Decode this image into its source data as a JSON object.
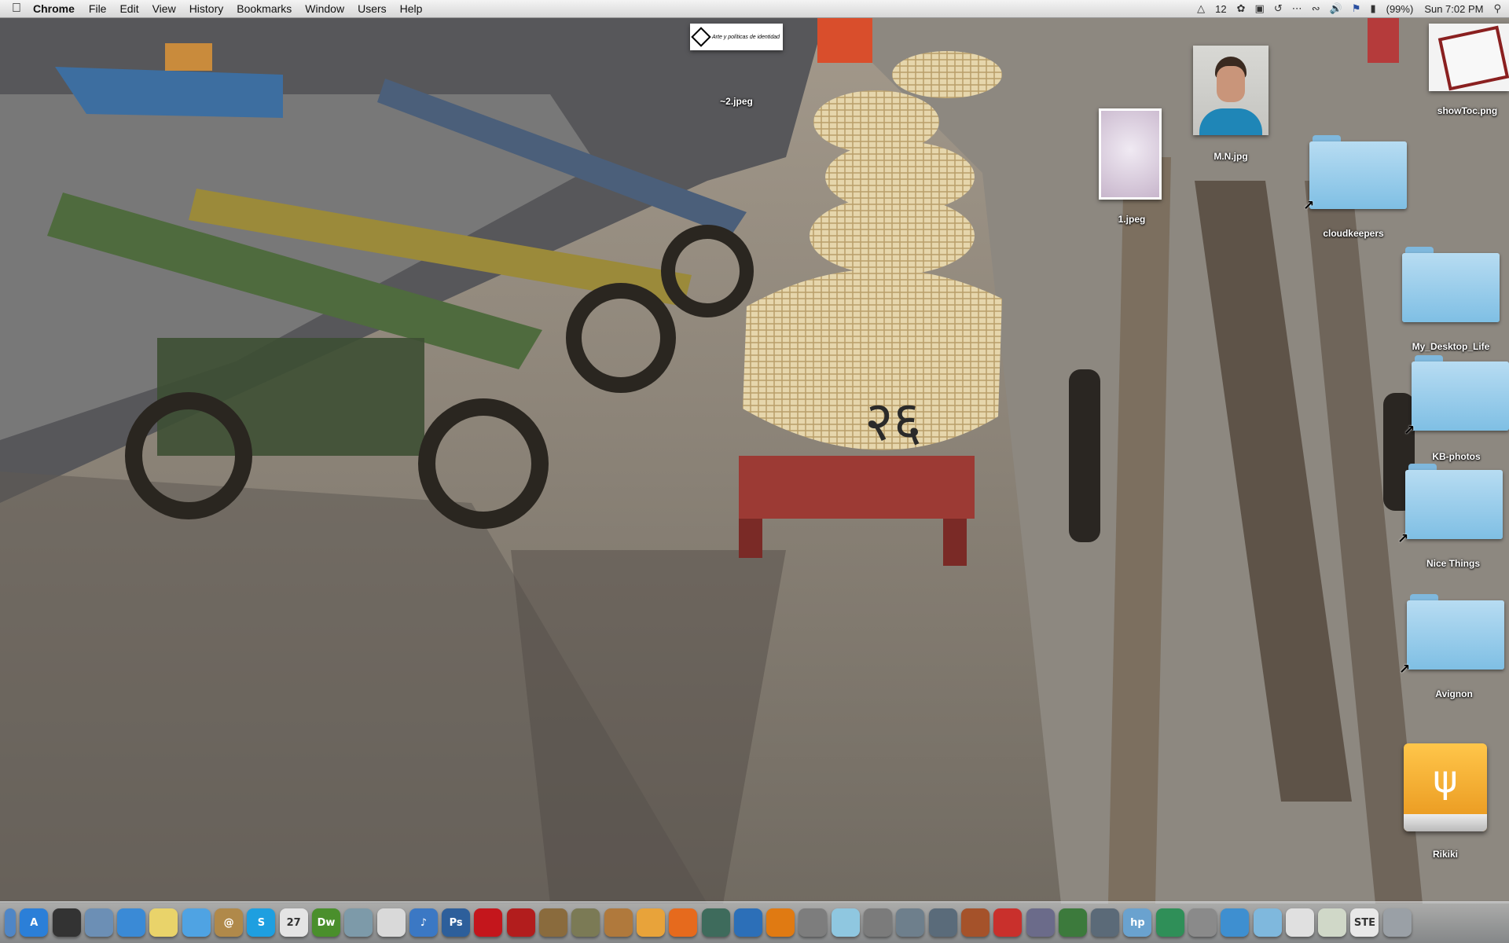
{
  "menubar": {
    "apple_icon": "apple-icon",
    "app_name": "Chrome",
    "menus": [
      "File",
      "Edit",
      "View",
      "History",
      "Bookmarks",
      "Window",
      "Users",
      "Help"
    ],
    "status_items": {
      "adobe_count": "12",
      "battery": "(99%)",
      "clock": "Sun 7:02 PM"
    },
    "status_icons": [
      "adobe-icon",
      "growl-icon",
      "display-icon",
      "time-machine-icon",
      "more-icon",
      "wifi-icon",
      "volume-icon",
      "flag-icon",
      "battery-icon",
      "spotlight-icon"
    ]
  },
  "desktop": {
    "items": [
      {
        "label": "~2.jpeg",
        "kind": "image"
      },
      {
        "label": "1.jpeg",
        "kind": "image"
      },
      {
        "label": "M.N.jpg",
        "kind": "image"
      },
      {
        "label": "showToc.png",
        "kind": "image"
      },
      {
        "label": "cloudkeepers",
        "kind": "folder-alias"
      },
      {
        "label": "My_Desktop_Life",
        "kind": "folder"
      },
      {
        "label": "KB-photos",
        "kind": "folder-alias"
      },
      {
        "label": "Nice Things",
        "kind": "folder-alias"
      },
      {
        "label": "Avignon",
        "kind": "folder-alias"
      },
      {
        "label": "Rikiki",
        "kind": "usb-drive"
      }
    ],
    "thumb_caption": "Arte y políticas de identidad"
  },
  "dock": {
    "items": [
      {
        "name": "finder-icon",
        "text": "",
        "color": "#4f86c6"
      },
      {
        "name": "app-store-icon",
        "text": "A",
        "color": "#2b7fd8"
      },
      {
        "name": "dashboard-icon",
        "text": "",
        "color": "#333333"
      },
      {
        "name": "preview-icon",
        "text": "",
        "color": "#6c8fb5"
      },
      {
        "name": "safari-icon",
        "text": "",
        "color": "#3a8ad6"
      },
      {
        "name": "stickies-icon",
        "text": "",
        "color": "#e9d36a"
      },
      {
        "name": "ichat-icon",
        "text": "",
        "color": "#4fa3e3"
      },
      {
        "name": "address-book-icon",
        "text": "@",
        "color": "#b0894a"
      },
      {
        "name": "skype-icon",
        "text": "S",
        "color": "#1e9fe0"
      },
      {
        "name": "ical-icon",
        "text": "27",
        "color": "#e4e4e4"
      },
      {
        "name": "dreamweaver-icon",
        "text": "Dw",
        "color": "#4a8f2c"
      },
      {
        "name": "iphoto-icon",
        "text": "",
        "color": "#7d9aa9"
      },
      {
        "name": "textedit-icon",
        "text": "",
        "color": "#d9d9d9"
      },
      {
        "name": "itunes-icon",
        "text": "♪",
        "color": "#3b78c4"
      },
      {
        "name": "photoshop-icon",
        "text": "Ps",
        "color": "#2d5f9b"
      },
      {
        "name": "acrobat-icon",
        "text": "",
        "color": "#c4161c"
      },
      {
        "name": "photo-booth-icon",
        "text": "",
        "color": "#b21d1d"
      },
      {
        "name": "image-capture-icon",
        "text": "",
        "color": "#8a6b3d"
      },
      {
        "name": "star-app-icon",
        "text": "",
        "color": "#7b7a55"
      },
      {
        "name": "garageband-icon",
        "text": "",
        "color": "#b0793c"
      },
      {
        "name": "chrome-icon",
        "text": "",
        "color": "#e8a33a"
      },
      {
        "name": "firefox-icon",
        "text": "",
        "color": "#e66a1d"
      },
      {
        "name": "time-machine-icon",
        "text": "",
        "color": "#3e6b5c"
      },
      {
        "name": "quicktime-icon",
        "text": "",
        "color": "#2c6fb8"
      },
      {
        "name": "vlc-icon",
        "text": "",
        "color": "#e07a12"
      },
      {
        "name": "dvd-player-icon",
        "text": "",
        "color": "#7d7d7d"
      },
      {
        "name": "text-document-icon",
        "text": "",
        "color": "#8fc7e0"
      },
      {
        "name": "system-preferences-icon",
        "text": "",
        "color": "#7b7b7b"
      },
      {
        "name": "screenshot-icon",
        "text": "",
        "color": "#6e7f8c"
      },
      {
        "name": "dictionary-icon",
        "text": "",
        "color": "#5a6b7a"
      },
      {
        "name": "keynote-icon",
        "text": "",
        "color": "#a5522a"
      },
      {
        "name": "pdf-icon",
        "text": "",
        "color": "#c9302c"
      },
      {
        "name": "script-editor-icon",
        "text": "",
        "color": "#6b6b8a"
      },
      {
        "name": "grapher-icon",
        "text": "",
        "color": "#3c7a3c"
      },
      {
        "name": "printer-icon",
        "text": "",
        "color": "#5b6a78"
      },
      {
        "name": "hp-utility-icon",
        "text": "hp",
        "color": "#6aa2cf"
      },
      {
        "name": "camino-icon",
        "text": "",
        "color": "#2f8f58"
      },
      {
        "name": "image-icon",
        "text": "",
        "color": "#8a8a8a"
      },
      {
        "name": "network-icon",
        "text": "",
        "color": "#3e8fd0"
      },
      {
        "name": "applications-folder-icon",
        "text": "",
        "color": "#7fb8dd"
      },
      {
        "name": "documents-stack-icon",
        "text": "",
        "color": "#e0e0e0"
      },
      {
        "name": "downloads-stack-icon",
        "text": "",
        "color": "#d0d8c8"
      },
      {
        "name": "ste-file-icon",
        "text": "STE",
        "color": "#e8e8e8"
      },
      {
        "name": "trash-icon",
        "text": "",
        "color": "#9aa0a6"
      }
    ]
  }
}
